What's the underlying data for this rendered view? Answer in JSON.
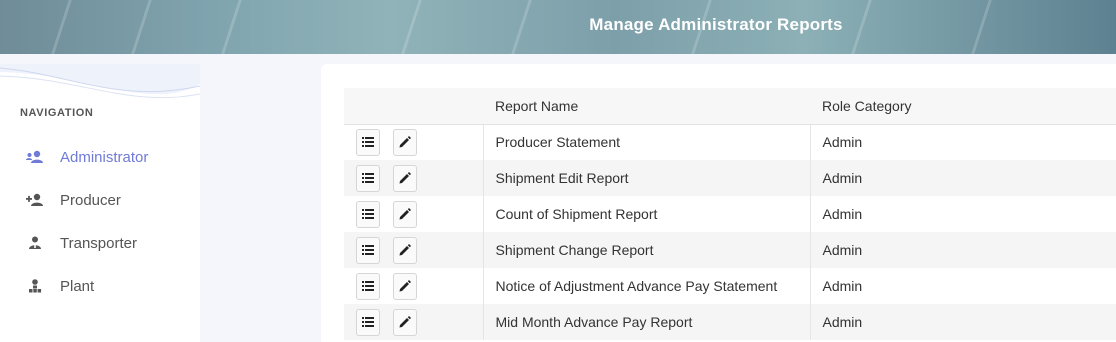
{
  "header": {
    "title": "Manage Administrator Reports"
  },
  "sidebar": {
    "heading": "NAVIGATION",
    "items": [
      {
        "label": "Administrator",
        "icon": "user-group-icon",
        "active": true
      },
      {
        "label": "Producer",
        "icon": "user-plus-icon",
        "active": false
      },
      {
        "label": "Transporter",
        "icon": "user-tie-icon",
        "active": false
      },
      {
        "label": "Plant",
        "icon": "user-sitemap-icon",
        "active": false
      }
    ]
  },
  "table": {
    "columns": [
      "",
      "Report Name",
      "Role Category"
    ],
    "rows": [
      {
        "name": "Producer Statement",
        "role": "Admin"
      },
      {
        "name": "Shipment Edit Report",
        "role": "Admin"
      },
      {
        "name": "Count of Shipment Report",
        "role": "Admin"
      },
      {
        "name": "Shipment Change Report",
        "role": "Admin"
      },
      {
        "name": "Notice of Adjustment Advance Pay Statement",
        "role": "Admin"
      },
      {
        "name": "Mid Month Advance Pay Report",
        "role": "Admin"
      }
    ],
    "row_actions": [
      "list-icon",
      "pencil-icon"
    ]
  },
  "colors": {
    "active_nav": "#6f7bd6",
    "banner": "#7fa3ae"
  }
}
